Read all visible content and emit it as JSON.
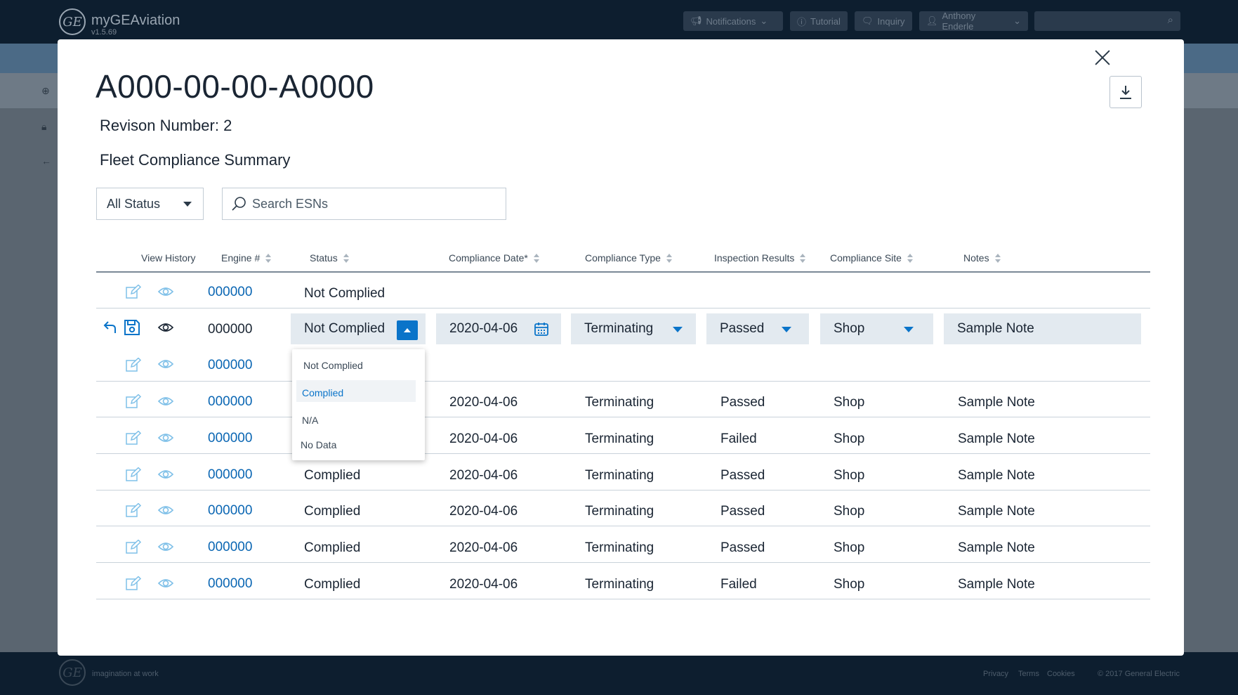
{
  "app": {
    "name": "myGEAviation",
    "version": "v1.5.69",
    "logo_text": "GE",
    "nav": {
      "notifications": "Notifications",
      "tutorial": "Tutorial",
      "inquiry": "Inquiry",
      "user": "Anthony Enderle"
    },
    "footer": {
      "tagline": "imagination at work",
      "privacy": "Privacy",
      "terms": "Terms",
      "cookies": "Cookies",
      "copyright": "© 2017 General Electric"
    }
  },
  "modal": {
    "title": "A000-00-00-A0000",
    "revision": "Revison Number: 2",
    "subtitle": "Fleet Compliance Summary",
    "status_filter": "All Status",
    "search_placeholder": "Search ESNs",
    "columns": {
      "view_history": "View History",
      "engine": "Engine #",
      "status": "Status",
      "compliance_date": "Compliance Date*",
      "compliance_type": "Compliance Type",
      "inspection_results": "Inspection Results",
      "compliance_site": "Compliance Site",
      "notes": "Notes"
    },
    "rows": [
      {
        "engine": "000000",
        "status": "Not Complied",
        "date": "",
        "type": "",
        "result": "",
        "site": "",
        "notes": ""
      },
      {
        "engine": "000000",
        "status": "Not Complied",
        "date": "2020-04-06",
        "type": "Terminating",
        "result": "Passed",
        "site": "Shop",
        "notes": "Sample Note"
      },
      {
        "engine": "000000",
        "status": "",
        "date": "",
        "type": "",
        "result": "",
        "site": "",
        "notes": ""
      },
      {
        "engine": "000000",
        "status": "",
        "date": "2020-04-06",
        "type": "Terminating",
        "result": "Passed",
        "site": "Shop",
        "notes": "Sample Note"
      },
      {
        "engine": "000000",
        "status": "",
        "date": "2020-04-06",
        "type": "Terminating",
        "result": "Failed",
        "site": "Shop",
        "notes": "Sample Note"
      },
      {
        "engine": "000000",
        "status": "Complied",
        "date": "2020-04-06",
        "type": "Terminating",
        "result": "Passed",
        "site": "Shop",
        "notes": "Sample Note"
      },
      {
        "engine": "000000",
        "status": "Complied",
        "date": "2020-04-06",
        "type": "Terminating",
        "result": "Passed",
        "site": "Shop",
        "notes": "Sample Note"
      },
      {
        "engine": "000000",
        "status": "Complied",
        "date": "2020-04-06",
        "type": "Terminating",
        "result": "Passed",
        "site": "Shop",
        "notes": "Sample Note"
      },
      {
        "engine": "000000",
        "status": "Complied",
        "date": "2020-04-06",
        "type": "Terminating",
        "result": "Failed",
        "site": "Shop",
        "notes": "Sample Note"
      }
    ],
    "status_options": [
      "Not Complied",
      "Complied",
      "N/A",
      "No Data"
    ],
    "highlighted_option": "Complied",
    "colors": {
      "link": "#0a66b3",
      "accent": "#0a74c9",
      "icon_light": "#7fc0e8",
      "edit_bg": "#e3eaf0"
    }
  }
}
